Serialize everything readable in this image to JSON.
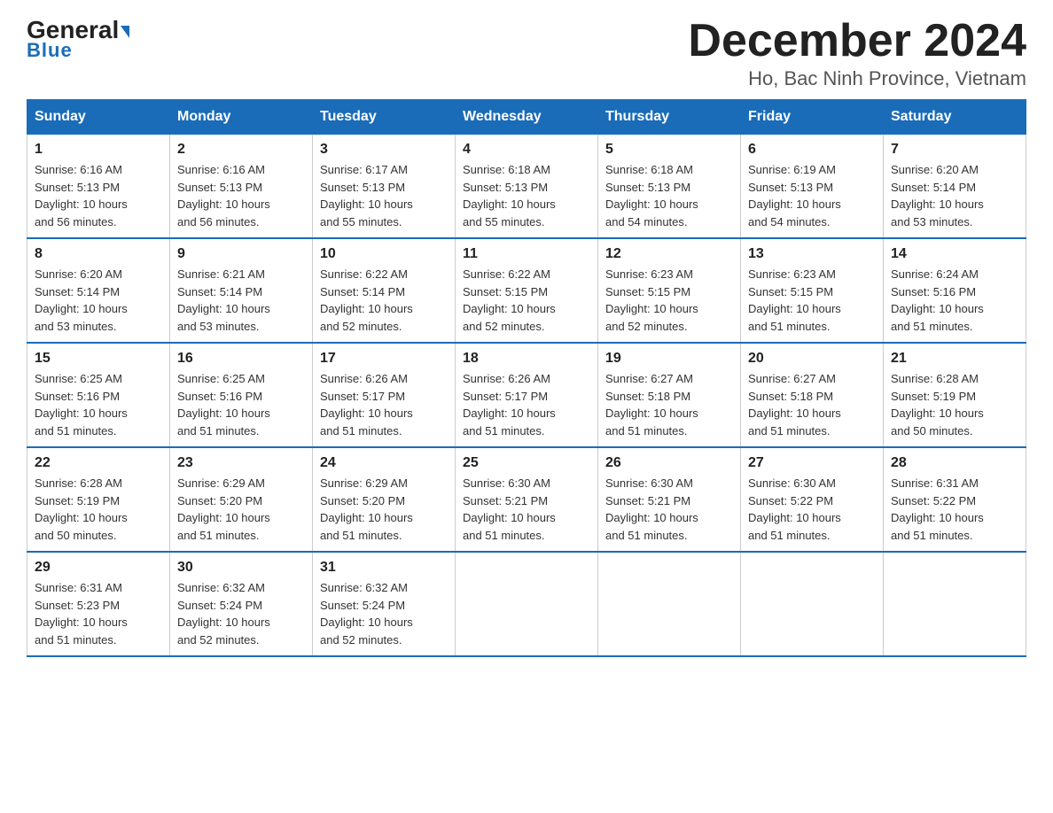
{
  "header": {
    "logo_general": "General",
    "logo_blue": "Blue",
    "month_title": "December 2024",
    "location": "Ho, Bac Ninh Province, Vietnam"
  },
  "weekdays": [
    "Sunday",
    "Monday",
    "Tuesday",
    "Wednesday",
    "Thursday",
    "Friday",
    "Saturday"
  ],
  "weeks": [
    [
      {
        "day": "1",
        "info": "Sunrise: 6:16 AM\nSunset: 5:13 PM\nDaylight: 10 hours\nand 56 minutes."
      },
      {
        "day": "2",
        "info": "Sunrise: 6:16 AM\nSunset: 5:13 PM\nDaylight: 10 hours\nand 56 minutes."
      },
      {
        "day": "3",
        "info": "Sunrise: 6:17 AM\nSunset: 5:13 PM\nDaylight: 10 hours\nand 55 minutes."
      },
      {
        "day": "4",
        "info": "Sunrise: 6:18 AM\nSunset: 5:13 PM\nDaylight: 10 hours\nand 55 minutes."
      },
      {
        "day": "5",
        "info": "Sunrise: 6:18 AM\nSunset: 5:13 PM\nDaylight: 10 hours\nand 54 minutes."
      },
      {
        "day": "6",
        "info": "Sunrise: 6:19 AM\nSunset: 5:13 PM\nDaylight: 10 hours\nand 54 minutes."
      },
      {
        "day": "7",
        "info": "Sunrise: 6:20 AM\nSunset: 5:14 PM\nDaylight: 10 hours\nand 53 minutes."
      }
    ],
    [
      {
        "day": "8",
        "info": "Sunrise: 6:20 AM\nSunset: 5:14 PM\nDaylight: 10 hours\nand 53 minutes."
      },
      {
        "day": "9",
        "info": "Sunrise: 6:21 AM\nSunset: 5:14 PM\nDaylight: 10 hours\nand 53 minutes."
      },
      {
        "day": "10",
        "info": "Sunrise: 6:22 AM\nSunset: 5:14 PM\nDaylight: 10 hours\nand 52 minutes."
      },
      {
        "day": "11",
        "info": "Sunrise: 6:22 AM\nSunset: 5:15 PM\nDaylight: 10 hours\nand 52 minutes."
      },
      {
        "day": "12",
        "info": "Sunrise: 6:23 AM\nSunset: 5:15 PM\nDaylight: 10 hours\nand 52 minutes."
      },
      {
        "day": "13",
        "info": "Sunrise: 6:23 AM\nSunset: 5:15 PM\nDaylight: 10 hours\nand 51 minutes."
      },
      {
        "day": "14",
        "info": "Sunrise: 6:24 AM\nSunset: 5:16 PM\nDaylight: 10 hours\nand 51 minutes."
      }
    ],
    [
      {
        "day": "15",
        "info": "Sunrise: 6:25 AM\nSunset: 5:16 PM\nDaylight: 10 hours\nand 51 minutes."
      },
      {
        "day": "16",
        "info": "Sunrise: 6:25 AM\nSunset: 5:16 PM\nDaylight: 10 hours\nand 51 minutes."
      },
      {
        "day": "17",
        "info": "Sunrise: 6:26 AM\nSunset: 5:17 PM\nDaylight: 10 hours\nand 51 minutes."
      },
      {
        "day": "18",
        "info": "Sunrise: 6:26 AM\nSunset: 5:17 PM\nDaylight: 10 hours\nand 51 minutes."
      },
      {
        "day": "19",
        "info": "Sunrise: 6:27 AM\nSunset: 5:18 PM\nDaylight: 10 hours\nand 51 minutes."
      },
      {
        "day": "20",
        "info": "Sunrise: 6:27 AM\nSunset: 5:18 PM\nDaylight: 10 hours\nand 51 minutes."
      },
      {
        "day": "21",
        "info": "Sunrise: 6:28 AM\nSunset: 5:19 PM\nDaylight: 10 hours\nand 50 minutes."
      }
    ],
    [
      {
        "day": "22",
        "info": "Sunrise: 6:28 AM\nSunset: 5:19 PM\nDaylight: 10 hours\nand 50 minutes."
      },
      {
        "day": "23",
        "info": "Sunrise: 6:29 AM\nSunset: 5:20 PM\nDaylight: 10 hours\nand 51 minutes."
      },
      {
        "day": "24",
        "info": "Sunrise: 6:29 AM\nSunset: 5:20 PM\nDaylight: 10 hours\nand 51 minutes."
      },
      {
        "day": "25",
        "info": "Sunrise: 6:30 AM\nSunset: 5:21 PM\nDaylight: 10 hours\nand 51 minutes."
      },
      {
        "day": "26",
        "info": "Sunrise: 6:30 AM\nSunset: 5:21 PM\nDaylight: 10 hours\nand 51 minutes."
      },
      {
        "day": "27",
        "info": "Sunrise: 6:30 AM\nSunset: 5:22 PM\nDaylight: 10 hours\nand 51 minutes."
      },
      {
        "day": "28",
        "info": "Sunrise: 6:31 AM\nSunset: 5:22 PM\nDaylight: 10 hours\nand 51 minutes."
      }
    ],
    [
      {
        "day": "29",
        "info": "Sunrise: 6:31 AM\nSunset: 5:23 PM\nDaylight: 10 hours\nand 51 minutes."
      },
      {
        "day": "30",
        "info": "Sunrise: 6:32 AM\nSunset: 5:24 PM\nDaylight: 10 hours\nand 52 minutes."
      },
      {
        "day": "31",
        "info": "Sunrise: 6:32 AM\nSunset: 5:24 PM\nDaylight: 10 hours\nand 52 minutes."
      },
      {
        "day": "",
        "info": ""
      },
      {
        "day": "",
        "info": ""
      },
      {
        "day": "",
        "info": ""
      },
      {
        "day": "",
        "info": ""
      }
    ]
  ]
}
